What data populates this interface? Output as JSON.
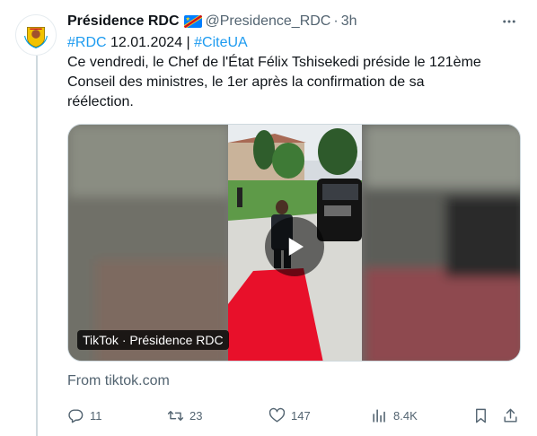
{
  "tweet": {
    "author_name": "Présidence RDC",
    "handle": "@Presidence_RDC",
    "separator": "·",
    "time": "3h",
    "text_line1_tag1": "#RDC",
    "text_line1_middle": " 12.01.2024 | ",
    "text_line1_tag2": "#CiteUA",
    "text_line2": "Ce vendredi, le Chef de l'État Félix Tshisekedi préside le 121ème",
    "text_line3": "Conseil des ministres, le 1er après la confirmation de sa",
    "text_line4": "réélection."
  },
  "media": {
    "badge": "TikTok · Présidence RDC",
    "source": "From tiktok.com"
  },
  "actions": {
    "replies": "11",
    "retweets": "23",
    "likes": "147",
    "views": "8.4K"
  },
  "icons": {
    "more": "more-horizontal-icon",
    "reply": "reply-icon",
    "retweet": "retweet-icon",
    "like": "heart-icon",
    "views": "views-chart-icon",
    "bookmark": "bookmark-icon",
    "share": "share-icon",
    "play": "play-icon",
    "flag": "drc-flag-icon"
  },
  "colors": {
    "link": "#1d9bf0",
    "muted": "#536471",
    "text": "#0f1419",
    "carpet": "#e8102a"
  }
}
